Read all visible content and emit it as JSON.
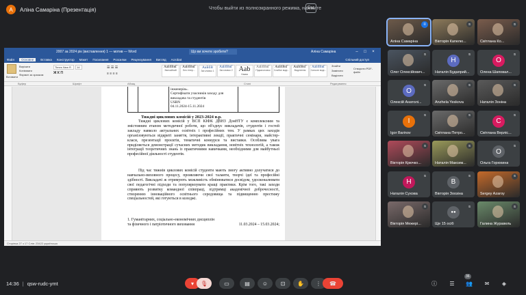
{
  "presenter": {
    "initial": "А",
    "label": "Аліна Самаріна (Презентація)"
  },
  "fullscreen": {
    "hint": "Чтобы выйти из полноэкранного режима, нажмите",
    "key": "Esc"
  },
  "word": {
    "title": "2007 за 2024 рік (виставлення) 1 — мотив — Word",
    "search_placeholder": "Що ви хочете зробити?",
    "user": "Аліна Самаріна",
    "tabs": [
      "Файл",
      "Основне",
      "Вставка",
      "Конструктор",
      "Макет",
      "Посилання",
      "Розсилки",
      "Рецензування",
      "Вигляд",
      "Acrobat"
    ],
    "share": "Спільний доступ",
    "font_name": "Times New R",
    "font_size": "14",
    "paste_label": "Вставити",
    "cut_label": "Вирізати",
    "copy_label": "Копіювати",
    "format_painter_label": "Формат за зразком",
    "styles": [
      {
        "sample": "АаБбВвГ",
        "name": "Звичайний"
      },
      {
        "sample": "АаБбВвГ",
        "name": "Без інтер..."
      },
      {
        "sample": "АаБбВ",
        "name": "Заголовок 1"
      },
      {
        "sample": "АаБбВвГ",
        "name": "Заголовок 2"
      },
      {
        "sample": "Aab",
        "name": "Назва"
      },
      {
        "sample": "АаБбВвГ",
        "name": "Підзаголовок"
      },
      {
        "sample": "АаБбВвГ",
        "name": "Слабке виді..."
      },
      {
        "sample": "АаБбВвГ",
        "name": "Виділення"
      },
      {
        "sample": "АаБбВвГ",
        "name": "Сильне виді..."
      }
    ],
    "find_label": "Знайти",
    "replace_label": "Замінити",
    "select_label": "Виділити",
    "pdf_label": "Створити PDF-файл",
    "groups": [
      "Буфер",
      "Шрифт",
      "Абзац",
      "Стилі",
      "Редагування"
    ],
    "table_cell": "інженерія».\nСертифікати учасників заходу для викладача та студентів\nUSRN\n04.11.2024-15.11.2024",
    "heading": "Тиждні циклових комісій у 2023-2024 н.р.",
    "para1": "Тиждні циклових комісій у ВСП КІФК ДВНЗ ДонНТУ є комплексним та змістовним етапом методичної роботи, що об'єднує викладачів, студентів і гостей закладу навколо актуальних освітніх і професійних тем. У рамках цих заходів організовуються відкриті заняття, інтерактивні лекції, практичні семінари, майстер-класи, презентації проєктів, тематичні конкурси та виставки. Особлива увага приділяється демонстрації сучасних методик викладання, новітніх технологій, а також інтеграції теоретичних знань із практичними навичками, необхідними для майбутньої професійної діяльності студентів.",
    "para2": "Під час тижнів циклових комісій студенти мають змогу активно долучатися до навчально-виховного процесу, проявляючи свої таланти, творчі ідеї та професійні здібності. Викладачі ж отримують можливість обмінюватися досвідом, удосконалювати свої педагогічні підходи та популяризувати кращі практики. Крім того, такі заходи сприяють розвитку командної співпраці, підтримці академічної доброчесності, створенню інноваційного освітнього середовища та підвищенню престижу спеціальностей, які готуються в коледжі.",
    "item1": "1. Гуманітарних, соціально-економічних дисциплін",
    "item2": "та фізичного і патріотичного виховання",
    "item2_date": "11.03.2024 – 15.03.2024;",
    "status": "Сторінка 27 з 17   Слів: 23422   українська"
  },
  "participants": [
    {
      "name": "Аліна Самаріна",
      "initial": "",
      "color": "#6d5a4a",
      "photo": true,
      "speaking": true
    },
    {
      "name": "Вікторія Капелю...",
      "initial": "",
      "color": "#8d7a5a",
      "photo": true
    },
    {
      "name": "Світлана Ко...",
      "initial": "",
      "color": "#7a5c4c",
      "photo": true
    },
    {
      "name": "Олег Олексійович...",
      "initial": "",
      "color": "#4a5460",
      "photo": true
    },
    {
      "name": "Наталія Будаприй...",
      "initial": "Н",
      "color": "#5c6bc0"
    },
    {
      "name": "Олена Шаповал...",
      "initial": "О",
      "color": "#d81b60"
    },
    {
      "name": "Олексій Анатолі...",
      "initial": "О",
      "color": "#5c6bc0"
    },
    {
      "name": "Anzhela Yeskova",
      "initial": "",
      "color": "#6a6a6a",
      "photo": true
    },
    {
      "name": "Наталія Зоніна",
      "initial": "",
      "color": "#5a5a5a",
      "photo": true
    },
    {
      "name": "Igor Barinov",
      "initial": "I",
      "color": "#e8710a"
    },
    {
      "name": "Світлана Петро...",
      "initial": "",
      "color": "#6a6a6a",
      "photo": true
    },
    {
      "name": "Світлана Верліс...",
      "initial": "С",
      "color": "#d81b60"
    },
    {
      "name": "Вікторія Крючко...",
      "initial": "",
      "color": "#b04a5a",
      "photo": true
    },
    {
      "name": "Наталія Максим...",
      "initial": "",
      "color": "#9a9a5a",
      "photo": true
    },
    {
      "name": "Ольга Горюхина",
      "initial": "О",
      "color": "#5f6368"
    },
    {
      "name": "Наталія Сухова",
      "initial": "Н",
      "color": "#c2185b"
    },
    {
      "name": "Вікторія Зоозіна",
      "initial": "В",
      "color": "#5f6368"
    },
    {
      "name": "Sergey Azaroy",
      "initial": "",
      "color": "#c56a2a",
      "photo": true
    },
    {
      "name": "Вікторія Межері...",
      "initial": "",
      "color": "#7a6a6a",
      "photo": true
    },
    {
      "name": "Ще 15 осіб",
      "initial": "",
      "color": "#5f6368",
      "more": true
    },
    {
      "name": "Галина Журавель",
      "initial": "",
      "color": "#6a8a6a",
      "photo": true
    }
  ],
  "meeting": {
    "time": "14:36",
    "code": "qsw-rudc-ymt",
    "count": "36"
  },
  "colors": {
    "bg": "#202124",
    "tile": "#3c4043",
    "red": "#ea4335",
    "word_blue": "#2b579a"
  }
}
